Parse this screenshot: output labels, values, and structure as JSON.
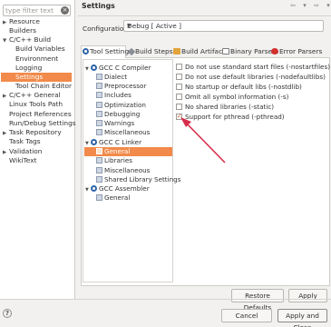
{
  "filter": {
    "placeholder": "type filter text"
  },
  "nav": [
    {
      "label": "Resource"
    },
    {
      "label": "Builders"
    },
    {
      "label": "C/C++ Build"
    },
    {
      "label": "Build Variables"
    },
    {
      "label": "Environment"
    },
    {
      "label": "Logging"
    },
    {
      "label": "Settings"
    },
    {
      "label": "Tool Chain Editor"
    },
    {
      "label": "C/C++ General"
    },
    {
      "label": "Linux Tools Path"
    },
    {
      "label": "Project References"
    },
    {
      "label": "Run/Debug Settings"
    },
    {
      "label": "Task Repository"
    },
    {
      "label": "Task Tags"
    },
    {
      "label": "Validation"
    },
    {
      "label": "WikiText"
    }
  ],
  "header": {
    "title": "Settings",
    "configuration_label": "Configuration:",
    "configuration_value": "Debug  [ Active ]"
  },
  "tabs": [
    {
      "label": "Tool Settings",
      "active": true
    },
    {
      "label": "Build Steps"
    },
    {
      "label": "Build Artifact"
    },
    {
      "label": "Binary Parsers"
    },
    {
      "label": "Error Parsers"
    }
  ],
  "tree": [
    {
      "label": "GCC C Compiler"
    },
    {
      "label": "Dialect"
    },
    {
      "label": "Preprocessor"
    },
    {
      "label": "Includes"
    },
    {
      "label": "Optimization"
    },
    {
      "label": "Debugging"
    },
    {
      "label": "Warnings"
    },
    {
      "label": "Miscellaneous"
    },
    {
      "label": "GCC C Linker"
    },
    {
      "label": "General"
    },
    {
      "label": "Libraries"
    },
    {
      "label": "Miscellaneous"
    },
    {
      "label": "Shared Library Settings"
    },
    {
      "label": "GCC Assembler"
    },
    {
      "label": "General"
    }
  ],
  "options": [
    {
      "label": "Do not use standard start files (-nostartfiles)",
      "checked": false
    },
    {
      "label": "Do not use default libraries (-nodefaultlibs)",
      "checked": false
    },
    {
      "label": "No startup or default libs (-nostdlib)",
      "checked": false
    },
    {
      "label": "Omit all symbol information (-s)",
      "checked": false
    },
    {
      "label": "No shared libraries (-static)",
      "checked": false
    },
    {
      "label": "Support for pthread (-pthread)",
      "checked": true
    }
  ],
  "buttons": {
    "restore_defaults": "Restore Defaults",
    "apply": "Apply",
    "cancel": "Cancel",
    "apply_and_close": "Apply and Close"
  },
  "help_icon": "?",
  "colors": {
    "selection": "#f18a4a",
    "arrow": "#d62d4a"
  }
}
